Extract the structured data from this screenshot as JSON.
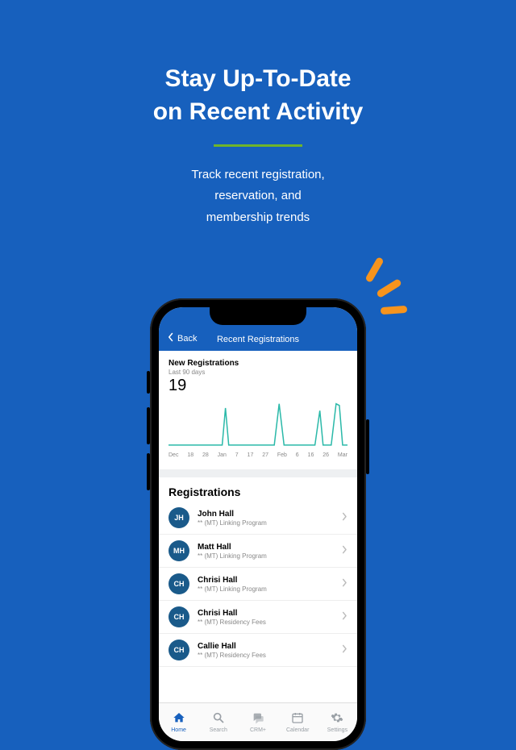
{
  "hero": {
    "title_line1": "Stay Up-To-Date",
    "title_line2": "on Recent Activity",
    "sub_line1": "Track recent registration,",
    "sub_line2": "reservation, and",
    "sub_line3": "membership trends"
  },
  "app": {
    "back_label": "Back",
    "header_title": "Recent Registrations",
    "chart_title": "New Registrations",
    "chart_subtitle": "Last 90 days",
    "chart_value": "19",
    "section_title": "Registrations"
  },
  "chart_data": {
    "type": "line",
    "title": "New Registrations — Last 90 days",
    "xlabel": "",
    "ylabel": "Registrations",
    "ylim": [
      0,
      6
    ],
    "x_ticks": [
      "Dec",
      "18",
      "28",
      "Jan",
      "7",
      "17",
      "27",
      "Feb",
      "6",
      "16",
      "26",
      "Mar"
    ],
    "series": [
      {
        "name": "New Registrations",
        "x": [
          "Dec 8",
          "Dec 18",
          "Dec 28",
          "Jan 1",
          "Jan 4",
          "Jan 7",
          "Jan 17",
          "Jan 27",
          "Feb 1",
          "Feb 6",
          "Feb 16",
          "Feb 20",
          "Feb 24",
          "Feb 26",
          "Mar 1",
          "Mar 3"
        ],
        "values": [
          0,
          0,
          0,
          0,
          4,
          0,
          0,
          0,
          5,
          0,
          0,
          0,
          4,
          0,
          5,
          5
        ]
      }
    ],
    "total": 19
  },
  "registrations": [
    {
      "initials": "JH",
      "name": "John Hall",
      "program": "** (MT) Linking Program"
    },
    {
      "initials": "MH",
      "name": "Matt Hall",
      "program": "** (MT) Linking Program"
    },
    {
      "initials": "CH",
      "name": "Chrisi Hall",
      "program": "** (MT) Linking Program"
    },
    {
      "initials": "CH",
      "name": "Chrisi Hall",
      "program": "** (MT) Residency Fees"
    },
    {
      "initials": "CH",
      "name": "Callie Hall",
      "program": "** (MT) Residency Fees"
    }
  ],
  "tabs": [
    {
      "label": "Home",
      "icon": "home-icon",
      "active": true
    },
    {
      "label": "Search",
      "icon": "search-icon",
      "active": false
    },
    {
      "label": "CRM+",
      "icon": "chat-icon",
      "active": false
    },
    {
      "label": "Calendar",
      "icon": "calendar-icon",
      "active": false
    },
    {
      "label": "Settings",
      "icon": "gear-icon",
      "active": false
    }
  ]
}
